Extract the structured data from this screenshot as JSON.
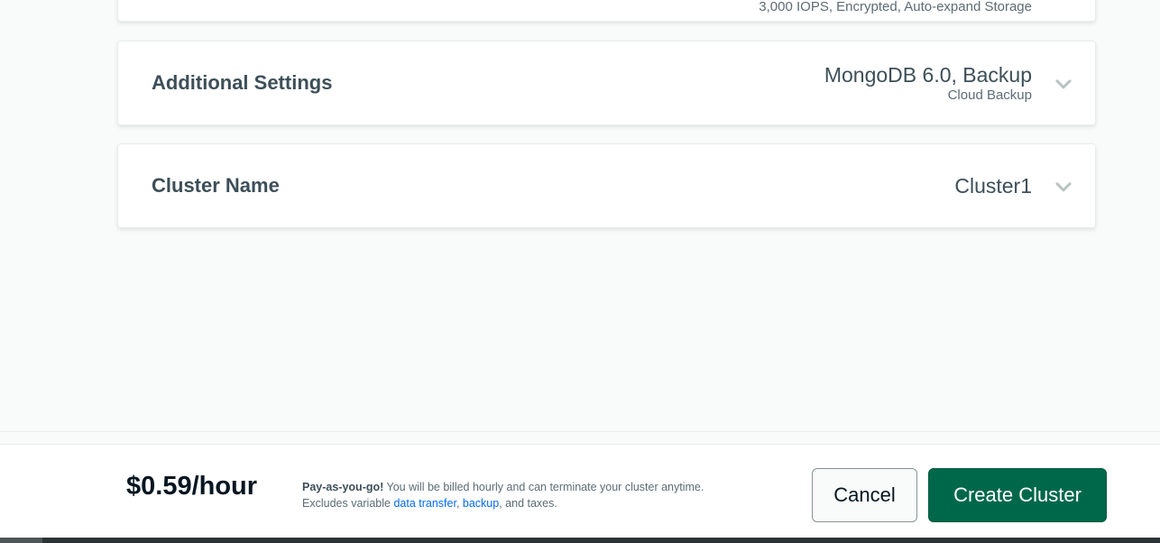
{
  "storage_card": {
    "summary_sub": "3,000 IOPS, Encrypted, Auto-expand Storage"
  },
  "additional_settings": {
    "title": "Additional Settings",
    "summary_main": "MongoDB 6.0, Backup",
    "summary_sub": "Cloud Backup",
    "icon": "chevron-down-icon"
  },
  "cluster_name": {
    "title": "Cluster Name",
    "summary_main": "Cluster1",
    "icon": "chevron-down-icon"
  },
  "footer": {
    "price": "$0.59/hour",
    "note_strong": "Pay-as-you-go!",
    "note_text": " You will be billed hourly and can terminate your cluster anytime.",
    "note_line2_prefix": "Excludes variable ",
    "link_data_transfer": "data transfer",
    "separator": ", ",
    "link_backup": "backup",
    "note_line2_suffix": ", and taxes.",
    "cancel_label": "Cancel",
    "create_label": "Create Cluster"
  },
  "colors": {
    "primary_button": "#00684a",
    "link": "#016bf8",
    "text": "#3d4f58"
  }
}
